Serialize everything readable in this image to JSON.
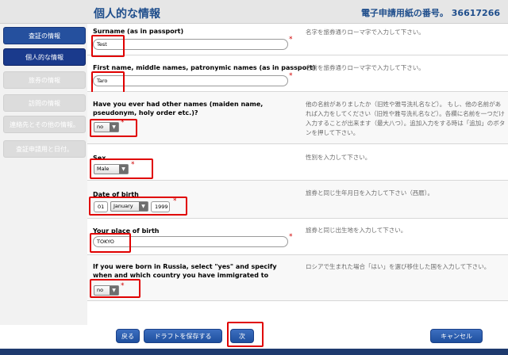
{
  "header": {
    "title": "個人的な情報",
    "form_number_label": "電子申請用紙の番号。 36617266"
  },
  "sidebar": {
    "items": [
      {
        "label": "査証の情報"
      },
      {
        "label": "個人的な情報"
      },
      {
        "label": "旅券の情報"
      },
      {
        "label": "訪問の情報"
      },
      {
        "label": "連絡先とその他の情報。"
      },
      {
        "label": "査証申請用と日付。"
      }
    ]
  },
  "form": {
    "surname": {
      "label": "Surname (as in passport)",
      "value": "Test",
      "hint": "名字を旅券通りローマ字で入力して下さい。"
    },
    "first_name": {
      "label": "First name, middle names, patronymic names (as in passport)",
      "value": "Taro",
      "hint": "名前を旅券通りローマ字で入力して下さい。"
    },
    "other_names": {
      "label": "Have you ever had other names (maiden name, pseudonym, holy order etc.)?",
      "value": "no",
      "hint": "他の名前がありましたか（旧姓や雅号洗礼名など）。 もし、他の名前があれば入力をしてください（旧姓や雅号洗礼名など）。各欄に名前を一つだけ入力することが出来ます（最大八つ）。追加入力をする時は「追加」のボタンを押して下さい。"
    },
    "sex": {
      "label": "Sex",
      "value": "Male",
      "hint": "性別を入力して下さい。"
    },
    "dob": {
      "label": "Date of birth",
      "day": "01",
      "month": "January",
      "year": "1999",
      "hint": "旅券と同じ生年月日を入力して下さい（西暦）。"
    },
    "birthplace": {
      "label": "Your place of birth",
      "value": "TOKYO",
      "hint": "旅券と同じ出生地を入力して下さい。"
    },
    "russia": {
      "label": "If you were born in Russia, select \"yes\" and specify when and which country you have immigrated to",
      "value": "no",
      "hint": "ロシアで生まれた場合「はい」を選び移住した国を入力して下さい。"
    }
  },
  "buttons": {
    "back": "戻る",
    "save_draft": "ドラフトを保存する",
    "next": "次",
    "cancel": "キャンセル"
  },
  "required_mark": "*"
}
